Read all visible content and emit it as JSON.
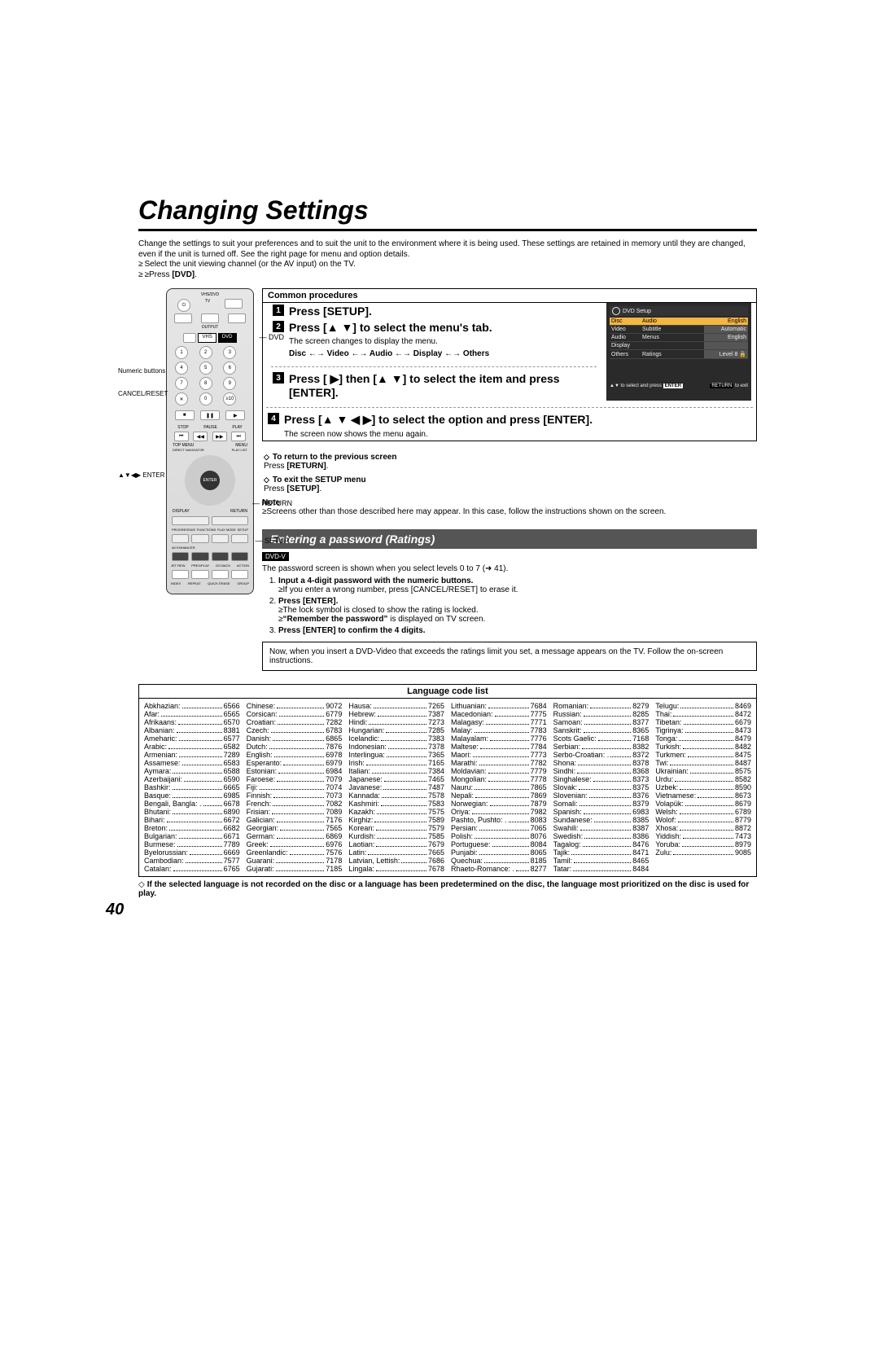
{
  "title": "Changing Settings",
  "intro": {
    "p1": "Change the settings to suit your preferences and to suit the unit to the environment where it is being used. These settings are retained in memory until they are changed, even if the unit is turned off. See the right page for menu and option details.",
    "b1": "Select the unit viewing channel (or the AV input) on the TV.",
    "b2": "Press [DVD]."
  },
  "remote": {
    "dvd": "DVD",
    "vhs": "VHS",
    "dvd_lbl": "DVD",
    "num_lbl": "Numeric buttons",
    "cancel_lbl": "CANCEL/RESET",
    "enter_lbl": "▲▼◀▶ ENTER",
    "return_lbl": "RETURN",
    "setup_lbl": "SETUP",
    "vhsdvd": "VHS/DVD",
    "tv": "TV",
    "output": "OUTPUT",
    "stop": "STOP",
    "pause": "PAUSE",
    "play": "PLAY",
    "topmenu": "TOP MENU",
    "directnav": "DIRECT NAVIGATOR",
    "menu": "MENU",
    "playlist": "PLAY LIST",
    "enter": "ENTER",
    "display": "DISPLAY",
    "return": "RETURN",
    "prog": "PROGRESSIVE",
    "func": "FUNCTIONS",
    "play2": "PLAY MODE",
    "setup": "SETUP",
    "avenh": "AV ENHANCER",
    "jetrew": "JET REW",
    "prevplay": "PREV/PLAY",
    "go": "GO BACK",
    "action": "ACTION",
    "index": "INDEX",
    "repeat": "REPEAT",
    "quickerase": "QUICK ERASE",
    "group": "GROUP"
  },
  "common_hdr": "Common procedures",
  "steps": {
    "s1": "Press [SETUP].",
    "s2": "Press [▲ ▼] to select the menu's tab.",
    "s2_sub": "The screen changes to display the menu.",
    "chain": "Disc ←→ Video ←→ Audio ←→ Display ←→ Others",
    "s3": "Press [ ▶] then [▲ ▼] to select the item and press [ENTER].",
    "s4": "Press [▲ ▼ ◀ ▶]  to select the option and press [ENTER].",
    "s4_sub": "The screen now shows the menu again."
  },
  "setup_screen": {
    "title": "DVD Setup",
    "rows": [
      {
        "tab": "Disc",
        "opt": "Audio",
        "val": "English",
        "hl": true
      },
      {
        "tab": "Video",
        "opt": "Subtitle",
        "val": "Automatic"
      },
      {
        "tab": "Audio",
        "opt": "Menus",
        "val": "English"
      },
      {
        "tab": "Display",
        "opt": "",
        "val": ""
      },
      {
        "tab": "Others",
        "opt": "Ratings",
        "val": "Level 8"
      }
    ],
    "foot_left": "to select  and press",
    "foot_enter": "ENTER",
    "foot_return": "RETURN",
    "foot_exit": "to exit"
  },
  "returns": {
    "r1_t": "To return to the previous screen",
    "r1_b": "Press [RETURN].",
    "r2_t": "To exit the SETUP menu",
    "r2_b": "Press [SETUP].",
    "note_lbl": "Note",
    "note": "Screens other than those described here may appear. In this case, follow the instructions shown on the screen."
  },
  "ratings": {
    "title": "Entering a password (Ratings)",
    "badge": "DVD-V",
    "intro": "The password screen is shown when you select levels 0 to 7 (➜ 41).",
    "li1": "Input a 4-digit password with the numeric buttons.",
    "li1_sub": "If you enter a wrong number, press [CANCEL/RESET] to erase it.",
    "li2": "Press [ENTER].",
    "li2_sub1": "The lock symbol is closed to show the rating is locked.",
    "li2_sub2_a": "“Remember the password”",
    "li2_sub2_b": " is displayed on TV screen.",
    "li3": "Press [ENTER] to confirm the 4 digits.",
    "boxnote": "Now, when you insert a DVD-Video that exceeds the ratings limit you set, a message appears on the TV. Follow the on-screen instructions."
  },
  "lang_hdr": "Language code list",
  "lang_note": "If the selected language is not recorded on the disc or a language has been predetermined on the disc, the language most prioritized on the disc is used for play.",
  "languages": [
    [
      "Abkhazian:",
      "6566"
    ],
    [
      "Afar:",
      "6565"
    ],
    [
      "Afrikaans:",
      "6570"
    ],
    [
      "Albanian:",
      "8381"
    ],
    [
      "Ameharic:",
      "6577"
    ],
    [
      "Arabic:",
      "6582"
    ],
    [
      "Armenian:",
      "7289"
    ],
    [
      "Assamese:",
      "6583"
    ],
    [
      "Aymara:",
      "6588"
    ],
    [
      "Azerbaijani:",
      "6590"
    ],
    [
      "Bashkir:",
      "6665"
    ],
    [
      "Basque:",
      "6985"
    ],
    [
      "Bengali, Bangla: .",
      "6678"
    ],
    [
      "Bhutani:",
      "6890"
    ],
    [
      "Bihari:",
      "6672"
    ],
    [
      "Breton:",
      "6682"
    ],
    [
      "Bulgarian:",
      "6671"
    ],
    [
      "Burmese:",
      "7789"
    ],
    [
      "Byelorussian:",
      "6669"
    ],
    [
      "Cambodian:",
      "7577"
    ],
    [
      "Catalan:",
      "6765"
    ],
    [
      "Chinese:",
      "9072"
    ],
    [
      "Corsican:",
      "6779"
    ],
    [
      "Croatian:",
      "7282"
    ],
    [
      "Czech:",
      "6783"
    ],
    [
      "Danish:",
      "6865"
    ],
    [
      "Dutch:",
      "7876"
    ],
    [
      "English:",
      "6978"
    ],
    [
      "Esperanto:",
      "6979"
    ],
    [
      "Estonian:",
      "6984"
    ],
    [
      "Faroese:",
      "7079"
    ],
    [
      "Fiji:",
      "7074"
    ],
    [
      "Finnish:",
      "7073"
    ],
    [
      "French:",
      "7082"
    ],
    [
      "Frisian:",
      "7089"
    ],
    [
      "Galician:",
      "7176"
    ],
    [
      "Georgian:",
      "7565"
    ],
    [
      "German:",
      "6869"
    ],
    [
      "Greek:",
      "6976"
    ],
    [
      "Greenlandic:",
      "7576"
    ],
    [
      "Guarani:",
      "7178"
    ],
    [
      "Gujarati:",
      "7185"
    ],
    [
      "Hausa:",
      "7265"
    ],
    [
      "Hebrew:",
      "7387"
    ],
    [
      "Hindi:",
      "7273"
    ],
    [
      "Hungarian:",
      "7285"
    ],
    [
      "Icelandic:",
      "7383"
    ],
    [
      "Indonesian:",
      "7378"
    ],
    [
      "Interlingua:",
      "7365"
    ],
    [
      "Irish:",
      "7165"
    ],
    [
      "Italian:",
      "7384"
    ],
    [
      "Japanese:",
      "7465"
    ],
    [
      "Javanese:",
      "7487"
    ],
    [
      "Kannada:",
      "7578"
    ],
    [
      "Kashmiri:",
      "7583"
    ],
    [
      "Kazakh:",
      "7575"
    ],
    [
      "Kirghiz:",
      "7589"
    ],
    [
      "Korean:",
      "7579"
    ],
    [
      "Kurdish:",
      "7585"
    ],
    [
      "Laotian:",
      "7679"
    ],
    [
      "Latin:",
      "7665"
    ],
    [
      "Latvian, Lettish:",
      "7686"
    ],
    [
      "Lingala:",
      "7678"
    ],
    [
      "Lithuanian:",
      "7684"
    ],
    [
      "Macedonian:",
      "7775"
    ],
    [
      "Malagasy:",
      "7771"
    ],
    [
      "Malay:",
      "7783"
    ],
    [
      "Malayalam:",
      "7776"
    ],
    [
      "Maltese:",
      "7784"
    ],
    [
      "Maori:",
      "7773"
    ],
    [
      "Marathi:",
      "7782"
    ],
    [
      "Moldavian:",
      "7779"
    ],
    [
      "Mongolian:",
      "7778"
    ],
    [
      "Nauru:",
      "7865"
    ],
    [
      "Nepali:",
      "7869"
    ],
    [
      "Norwegian:",
      "7879"
    ],
    [
      "Oriya:",
      "7982"
    ],
    [
      "Pashto, Pushto: .",
      "8083"
    ],
    [
      "Persian:",
      "7065"
    ],
    [
      "Polish:",
      "8076"
    ],
    [
      "Portuguese:",
      "8084"
    ],
    [
      "Punjabi:",
      "8065"
    ],
    [
      "Quechua:",
      "8185"
    ],
    [
      "Rhaeto-Romance: .",
      "8277"
    ],
    [
      "Romanian:",
      "8279"
    ],
    [
      "Russian:",
      "8285"
    ],
    [
      "Samoan:",
      "8377"
    ],
    [
      "Sanskrit:",
      "8365"
    ],
    [
      "Scots Gaelic:",
      "7168"
    ],
    [
      "Serbian:",
      "8382"
    ],
    [
      "Serbo-Croatian: .",
      "8372"
    ],
    [
      "Shona:",
      "8378"
    ],
    [
      "Sindhi:",
      "8368"
    ],
    [
      "Singhalese:",
      "8373"
    ],
    [
      "Slovak:",
      "8375"
    ],
    [
      "Slovenian:",
      "8376"
    ],
    [
      "Somali:",
      "8379"
    ],
    [
      "Spanish:",
      "6983"
    ],
    [
      "Sundanese:",
      "8385"
    ],
    [
      "Swahili:",
      "8387"
    ],
    [
      "Swedish:",
      "8386"
    ],
    [
      "Tagalog:",
      "8476"
    ],
    [
      "Tajik:",
      "8471"
    ],
    [
      "Tamil:",
      "8465"
    ],
    [
      "Tatar:",
      "8484"
    ],
    [
      "Telugu:",
      "8469"
    ],
    [
      "Thai:",
      "8472"
    ],
    [
      "Tibetan:",
      "6679"
    ],
    [
      "Tigrinya:",
      "8473"
    ],
    [
      "Tonga:",
      "8479"
    ],
    [
      "Turkish:",
      "8482"
    ],
    [
      "Turkmen:",
      "8475"
    ],
    [
      "Twi:",
      "8487"
    ],
    [
      "Ukrainian:",
      "8575"
    ],
    [
      "Urdu:",
      "8582"
    ],
    [
      "Uzbek:",
      "8590"
    ],
    [
      "Vietnamese:",
      "8673"
    ],
    [
      "Volapük:",
      "8679"
    ],
    [
      "Welsh:",
      "6789"
    ],
    [
      "Wolof:",
      "8779"
    ],
    [
      "Xhosa:",
      "8872"
    ],
    [
      "Yiddish:",
      "7473"
    ],
    [
      "Yoruba:",
      "8979"
    ],
    [
      "Zulu:",
      "9085"
    ]
  ],
  "page_num": "40"
}
